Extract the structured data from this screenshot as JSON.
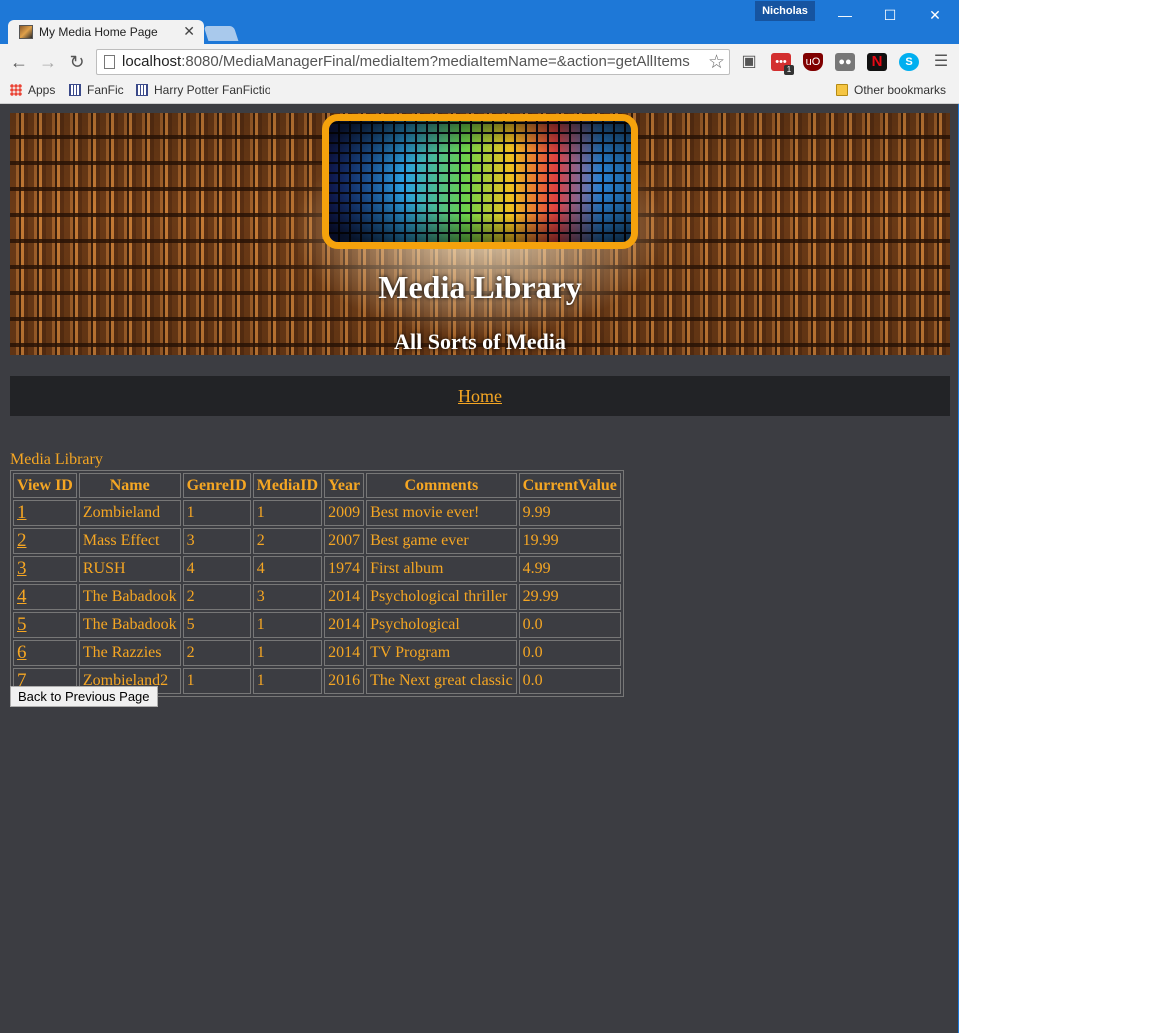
{
  "browser": {
    "tab_title": "My Media Home Page",
    "tab_close": "✕",
    "user_name": "Nicholas",
    "url_host": "localhost",
    "url_rest": ":8080/MediaManagerFinal/mediaItem?mediaItemName=&action=getAllItems",
    "bookmarks": {
      "apps": "Apps",
      "fanfic": "FanFic",
      "hp_fanfic": "Harry Potter FanFictio",
      "other": "Other bookmarks"
    },
    "extension_badge": "1"
  },
  "header": {
    "title": "Media Library",
    "subtitle": "All Sorts of Media"
  },
  "nav": {
    "home": "Home"
  },
  "table": {
    "caption": "Media Library",
    "columns": [
      "View ID",
      "Name",
      "GenreID",
      "MediaID",
      "Year",
      "Comments",
      "CurrentValue"
    ],
    "rows": [
      [
        "1",
        "Zombieland",
        "1",
        "1",
        "2009",
        "Best movie ever!",
        "9.99"
      ],
      [
        "2",
        "Mass Effect",
        "3",
        "2",
        "2007",
        "Best game ever",
        "19.99"
      ],
      [
        "3",
        "RUSH",
        "4",
        "4",
        "1974",
        "First album",
        "4.99"
      ],
      [
        "4",
        "The Babadook",
        "2",
        "3",
        "2014",
        "Psychological thriller",
        "29.99"
      ],
      [
        "5",
        "The Babadook",
        "5",
        "1",
        "2014",
        "Psychological",
        "0.0"
      ],
      [
        "6",
        "The Razzies",
        "2",
        "1",
        "2014",
        "TV Program",
        "0.0"
      ],
      [
        "7",
        "Zombieland2",
        "1",
        "1",
        "2016",
        "The Next great classic",
        "0.0"
      ]
    ]
  },
  "back_button": "Back to Previous Page",
  "colors": {
    "page_bg": "#3c3d42",
    "accent": "#f5a623",
    "nav_bg": "#222326",
    "chrome_blue": "#1e78d7"
  }
}
